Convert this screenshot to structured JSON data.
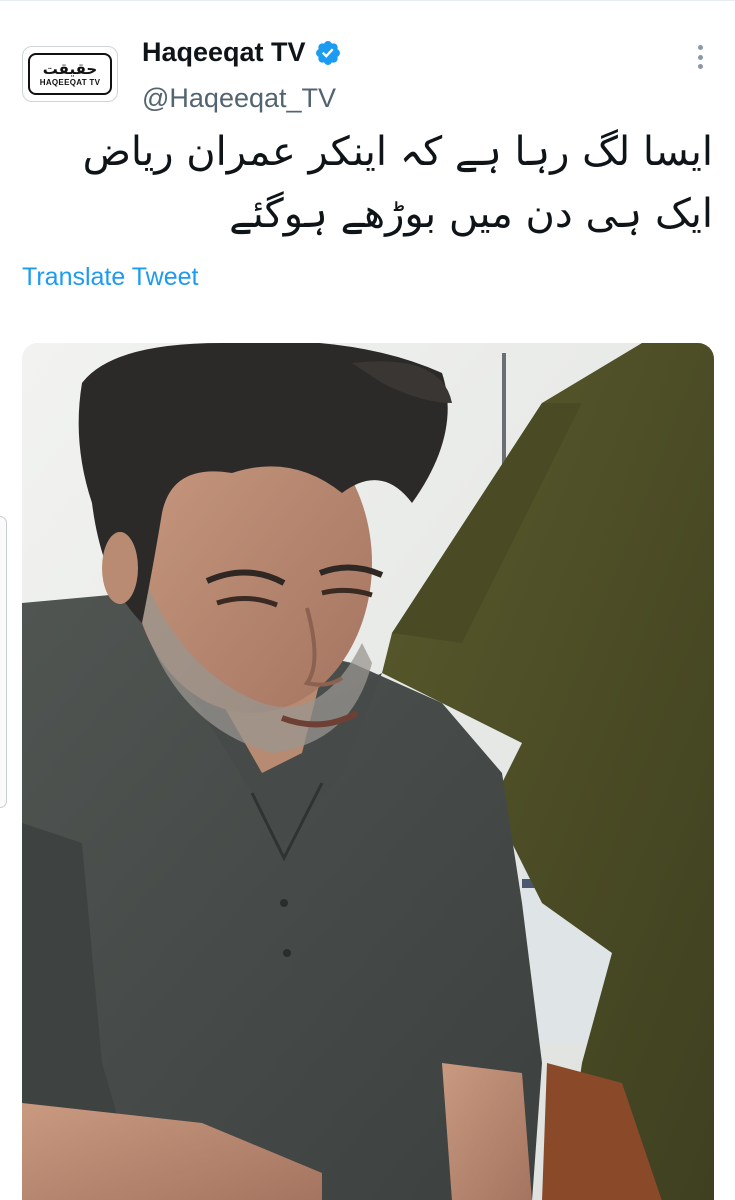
{
  "account": {
    "display_name": "Haqeeqat TV",
    "handle": "@Haqeeqat_TV",
    "verified_icon": "verified-badge-icon",
    "logo_urdu": "حقیقت",
    "logo_english": "HAQEEQAT TV"
  },
  "tweet": {
    "text": "ایسا لگ رہا ہے کہ اینکر عمران ریاض ایک ہی دن میں بوڑھے ہوگئے",
    "translate_label": "Translate Tweet"
  },
  "icons": {
    "more": "more-options-icon"
  },
  "colors": {
    "link": "#1d9bf0",
    "verified": "#1d9bf0",
    "text": "#0f1419",
    "secondary": "#536471"
  }
}
